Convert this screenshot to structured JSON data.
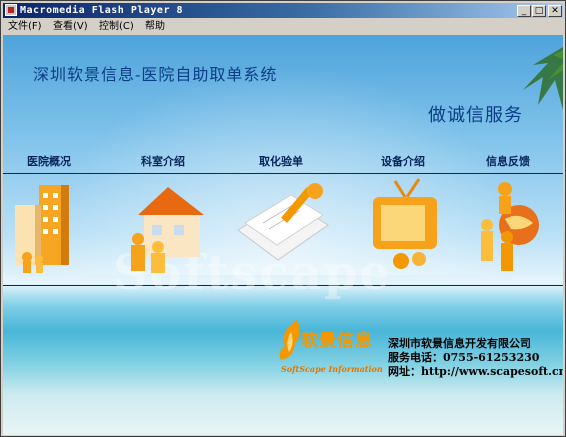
{
  "window": {
    "title": "Macromedia Flash Player 8",
    "controls": {
      "minimize": "_",
      "maximize": "□",
      "close": "✕"
    }
  },
  "menu": [
    "文件(F)",
    "查看(V)",
    "控制(C)",
    "帮助"
  ],
  "app": {
    "title": "深圳软景信息-医院自助取单系统",
    "slogan": "做诚信服务",
    "nav": [
      {
        "label": "医院概况",
        "icon": "hospital-buildings-icon"
      },
      {
        "label": "科室介绍",
        "icon": "house-people-icon"
      },
      {
        "label": "取化验单",
        "icon": "documents-pen-icon"
      },
      {
        "label": "设备介绍",
        "icon": "tv-equipment-icon"
      },
      {
        "label": "信息反馈",
        "icon": "globe-people-icon"
      }
    ],
    "watermark": "Softscape",
    "logo": {
      "text": "软景信息",
      "subtitle": "SoftScape Information"
    },
    "company": {
      "name": "深圳市软景信息开发有限公司",
      "phone": "服务电话：0755-61253230",
      "website": "网址：http://www.scapesoft.cn"
    }
  },
  "colors": {
    "title_text": "#0b3e86",
    "accent_orange": "#f39800",
    "titlebar": "#0a246a"
  }
}
